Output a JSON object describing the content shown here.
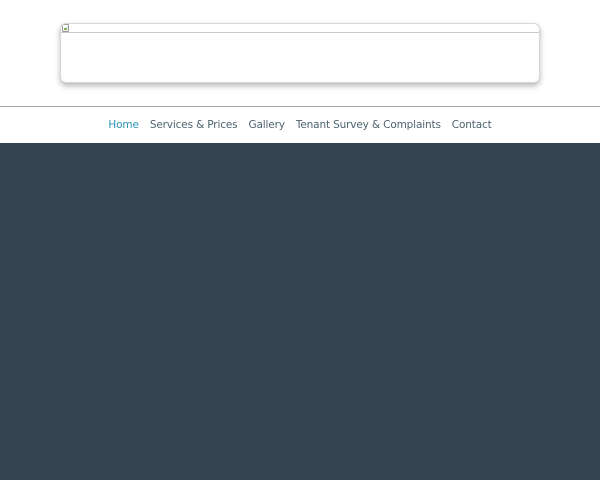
{
  "header": {
    "banner_image": "broken-image"
  },
  "nav": {
    "items": [
      {
        "label": "Home",
        "active": true
      },
      {
        "label": "Services & Prices",
        "active": false
      },
      {
        "label": "Gallery",
        "active": false
      },
      {
        "label": "Tenant Survey & Complaints",
        "active": false
      },
      {
        "label": "Contact",
        "active": false
      }
    ]
  },
  "colors": {
    "nav_active": "#2b93ba",
    "nav_text": "#4d6470",
    "main_background": "#34454f"
  }
}
